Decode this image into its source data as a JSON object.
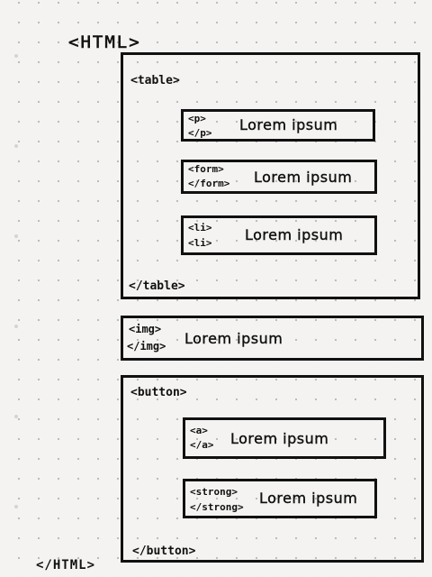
{
  "html_open": "<HTML>",
  "html_close": "</HTML>",
  "table": {
    "open": "<table>",
    "close": "</table>",
    "items": [
      {
        "open": "<p>",
        "close": "</p>",
        "text": "Lorem ipsum"
      },
      {
        "open": "<form>",
        "close": "</form>",
        "text": "Lorem ipsum"
      },
      {
        "open": "<li>",
        "close": "<li>",
        "text": "Lorem ipsum"
      }
    ]
  },
  "img": {
    "open": "<img>",
    "close": "</img>",
    "text": "Lorem ipsum"
  },
  "button": {
    "open": "<button>",
    "close": "</button>",
    "items": [
      {
        "open": "<a>",
        "close": "</a>",
        "text": "Lorem ipsum"
      },
      {
        "open": "<strong>",
        "close": "</strong>",
        "text": "Lorem ipsum"
      }
    ]
  }
}
